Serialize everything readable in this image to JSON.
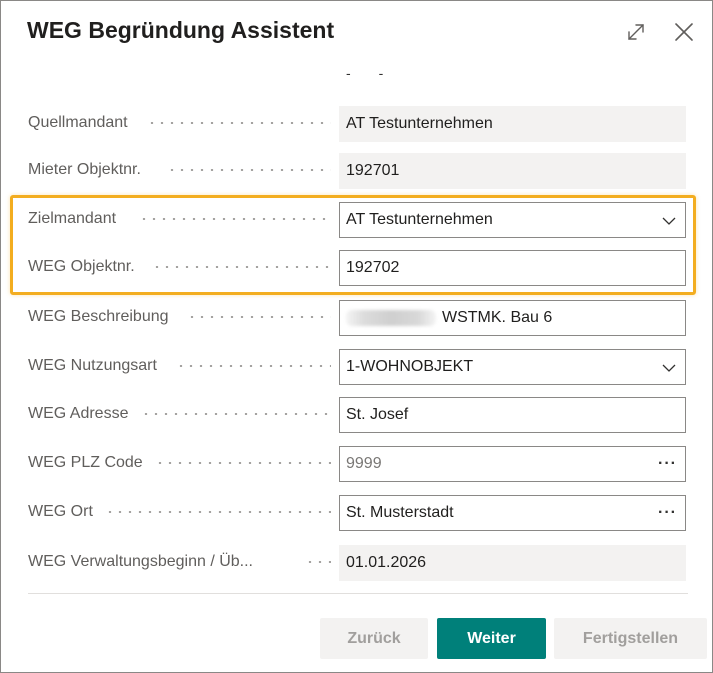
{
  "dialog": {
    "title": "WEG Begründung Assistent",
    "icons": {
      "expand": "expand-icon",
      "close": "close-icon"
    }
  },
  "tabs_stub": [
    "-",
    "-"
  ],
  "fields": [
    {
      "key": "quellmandant",
      "label": "Quellmandant",
      "value": "AT Testunternehmen",
      "kind": "readonly"
    },
    {
      "key": "mieter_objektnr",
      "label": "Mieter Objektnr.",
      "value": "192701",
      "kind": "readonly"
    },
    {
      "key": "zielmandant",
      "label": "Zielmandant",
      "value": "AT Testunternehmen",
      "kind": "dropdown"
    },
    {
      "key": "weg_objektnr",
      "label": "WEG Objektnr.",
      "value": "192702",
      "kind": "text"
    },
    {
      "key": "weg_beschreibung",
      "label": "WEG Beschreibung",
      "value": "WSTMK. Bau 6",
      "kind": "text",
      "redacted_prefix": true
    },
    {
      "key": "weg_nutzungsart",
      "label": "WEG Nutzungsart",
      "value": "1-WOHNOBJEKT",
      "kind": "dropdown"
    },
    {
      "key": "weg_adresse",
      "label": "WEG Adresse",
      "value": "St. Josef",
      "kind": "text"
    },
    {
      "key": "weg_plz_code",
      "label": "WEG PLZ Code",
      "value": "9999",
      "kind": "lookup",
      "muted": true
    },
    {
      "key": "weg_ort",
      "label": "WEG Ort",
      "value": "St. Musterstadt",
      "kind": "lookup"
    },
    {
      "key": "weg_verwaltungsbeginn",
      "label": "WEG Verwaltungsbeginn / Üb...",
      "value": "01.01.2026",
      "kind": "readonly"
    }
  ],
  "lookup_glyph": "···",
  "buttons": {
    "back": "Zurück",
    "next": "Weiter",
    "finish": "Fertigstellen"
  },
  "colors": {
    "accent": "#00807a",
    "highlight": "#f3ad1f",
    "readonly_bg": "#f3f2f1"
  }
}
